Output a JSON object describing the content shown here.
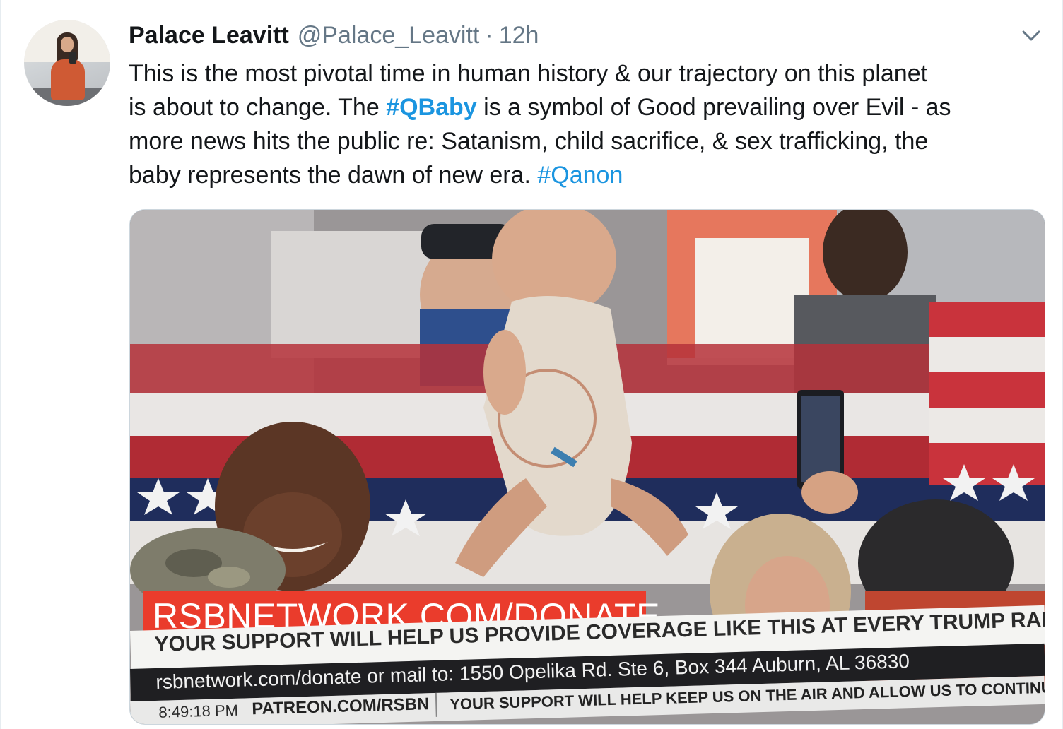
{
  "tweet": {
    "author_name": "Palace Leavitt",
    "handle": "@Palace_Leavitt",
    "separator": "·",
    "time": "12h",
    "text": {
      "line1": "This is the most pivotal time in human history & our trajectory on this planet",
      "line2_before": "is about to change. The ",
      "hashtag1": "#QBaby",
      "line2_after": " is a symbol of Good prevailing over Evil - as",
      "line3": "more news hits the public re: Satanism, child sacrifice, & sex trafficking, the",
      "line4_before": "baby represents the dawn of new era. ",
      "hashtag2": "#Qanon"
    }
  },
  "media": {
    "chyron_red": "RSBNETWORK.COM/DONATE",
    "chyron_white": "YOUR SUPPORT WILL HELP US PROVIDE COVERAGE LIKE THIS AT EVERY TRUMP RAL",
    "chyron_dark": "rsbnetwork.com/donate or mail to: 1550 Opelika Rd. Ste 6, Box 344 Auburn, AL 36830",
    "ticker_clock": "8:49:18 PM",
    "ticker_patreon": "PATREON.COM/RSBN",
    "ticker_message": "YOUR SUPPORT WILL HELP KEEP US ON THE AIR AND ALLOW US TO CONTINU"
  },
  "icons": {
    "menu": "chevron-down-icon",
    "avatar": "profile-avatar"
  },
  "colors": {
    "link": "#1b95e0",
    "text": "#14171a",
    "secondary": "#657786",
    "chyron_red": "#ea3c2c"
  }
}
